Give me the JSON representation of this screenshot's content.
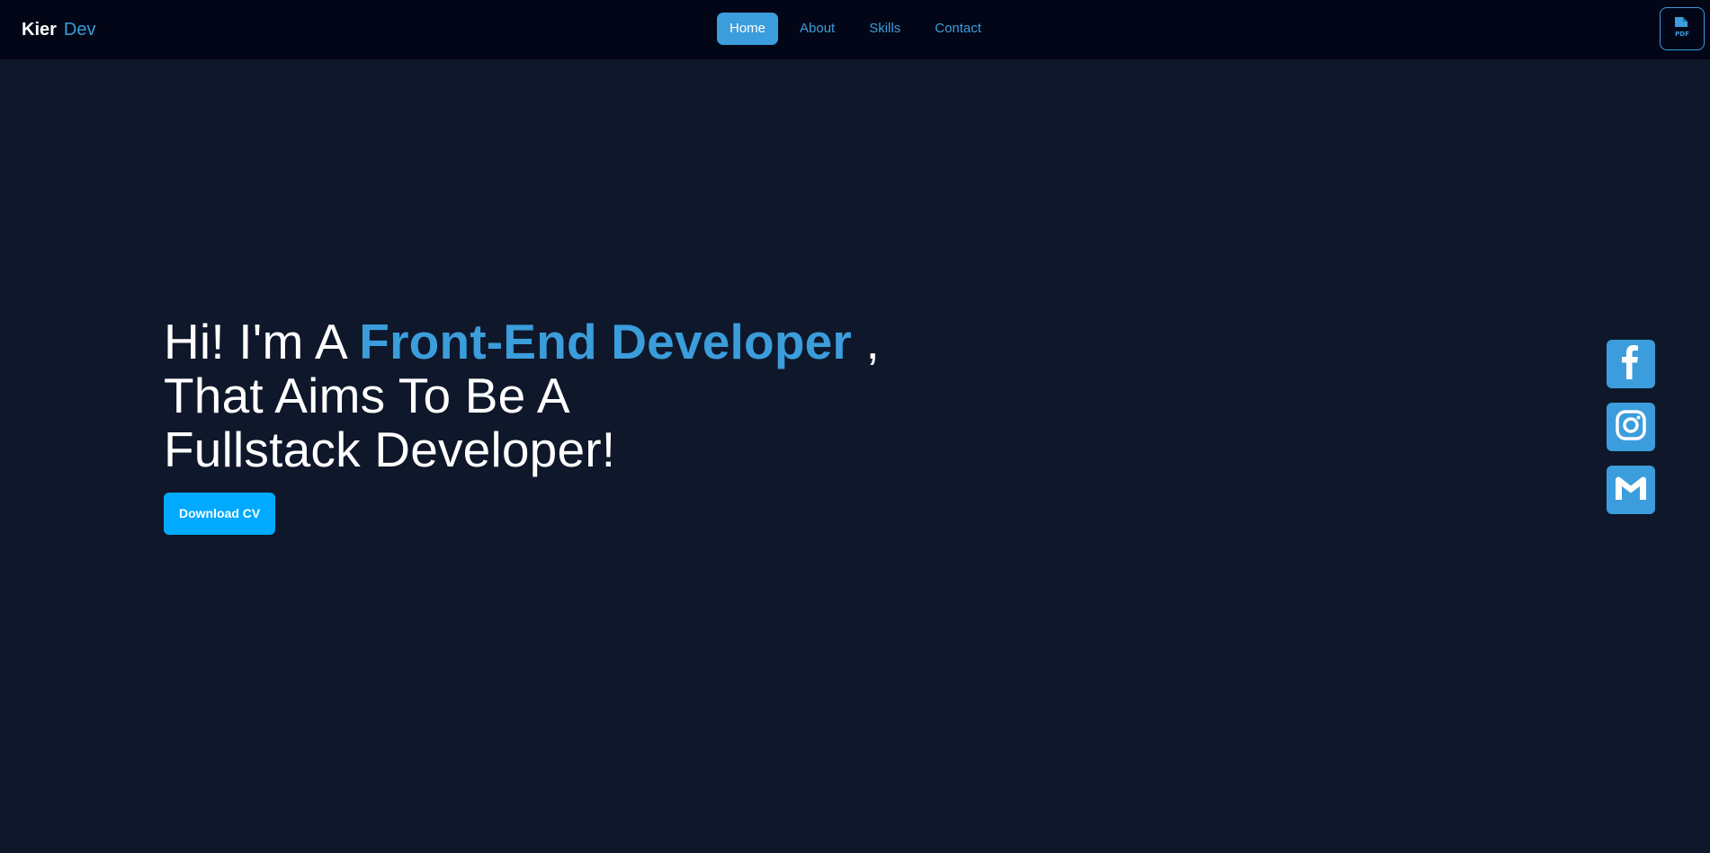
{
  "brand": {
    "first": "Kier",
    "second": "Dev"
  },
  "nav": {
    "items": [
      {
        "label": "Home",
        "active": true
      },
      {
        "label": "About",
        "active": false
      },
      {
        "label": "Skills",
        "active": false
      },
      {
        "label": "Contact",
        "active": false
      }
    ]
  },
  "header": {
    "pdf_icon": "pdf-file-icon",
    "pdf_icon_text": "PDF"
  },
  "hero": {
    "prefix": "Hi! I'm A ",
    "highlight": "Front-End Developer",
    "suffix": " ,",
    "line2": "That Aims To Be A",
    "line3": "Fullstack Developer!",
    "cta_label": "Download CV"
  },
  "social": {
    "items": [
      {
        "name": "facebook",
        "icon": "facebook-icon"
      },
      {
        "name": "instagram",
        "icon": "instagram-icon"
      },
      {
        "name": "gmail",
        "icon": "gmail-icon"
      }
    ]
  },
  "colors": {
    "background": "#0f172a",
    "navbar": "#020617",
    "accent": "#3b9ddb",
    "cta": "#00aaff",
    "text": "#ffffff"
  }
}
